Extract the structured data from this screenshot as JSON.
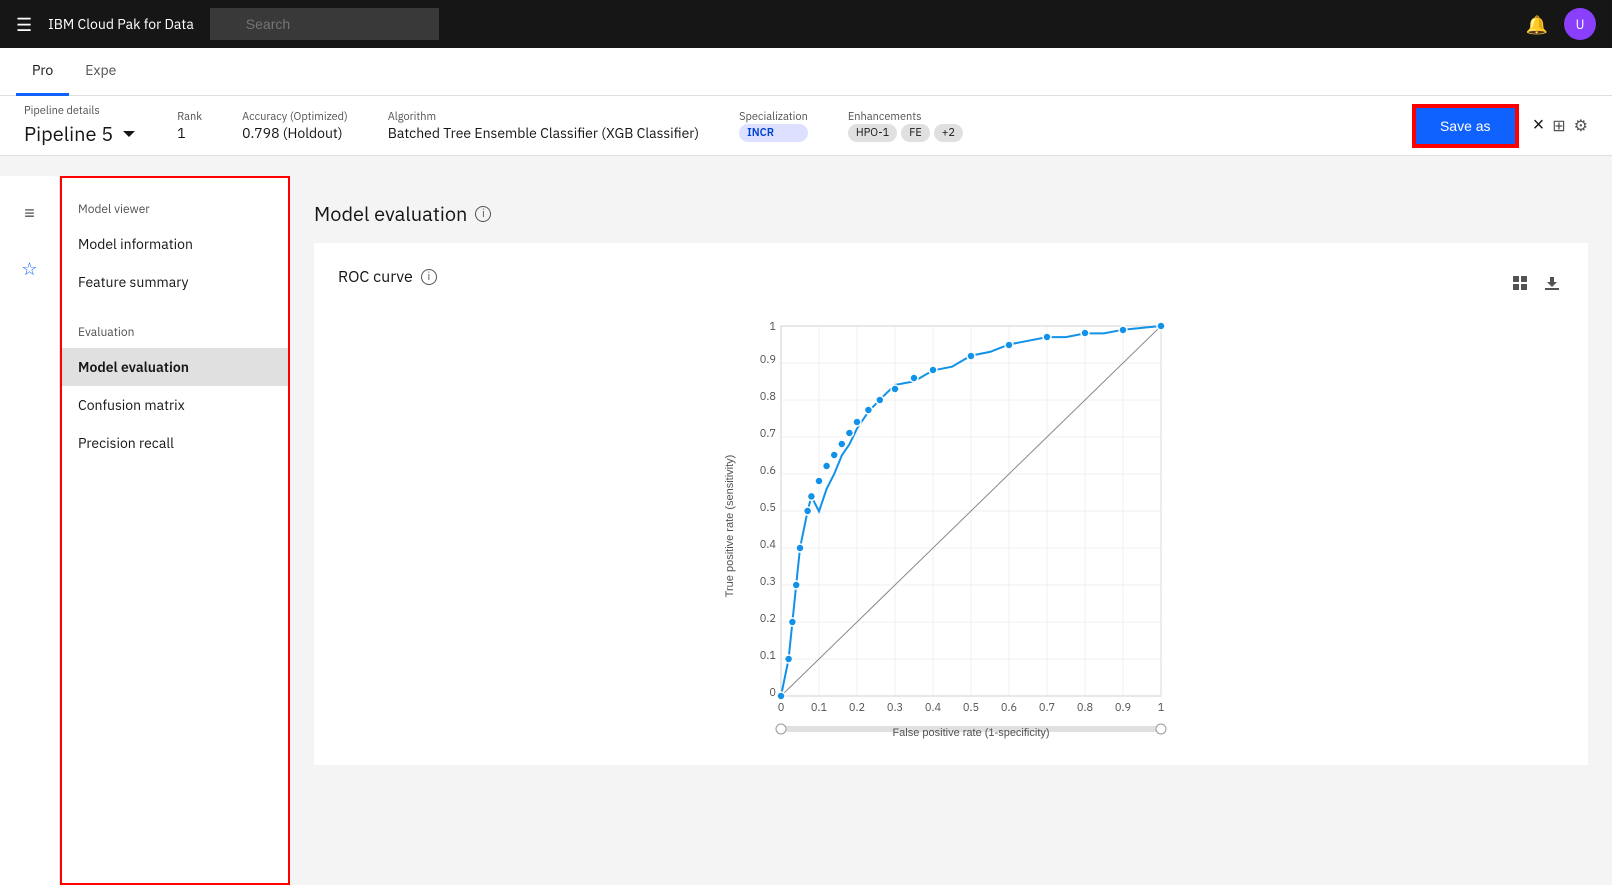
{
  "topnav": {
    "brand": "IBM Cloud Pak for Data",
    "search_placeholder": "Search",
    "menu_icon": "☰",
    "notification_icon": "🔔",
    "avatar_initials": "U"
  },
  "secondnav": {
    "tabs": [
      {
        "label": "Pro",
        "active": true
      },
      {
        "label": "Expe",
        "active": false
      }
    ]
  },
  "pipeline_header": {
    "details_label": "Pipeline details",
    "title": "Pipeline 5",
    "rank_label": "Rank",
    "rank_value": "1",
    "accuracy_label": "Accuracy (Optimized)",
    "accuracy_value": "0.798 (Holdout)",
    "algorithm_label": "Algorithm",
    "algorithm_value": "Batched Tree Ensemble Classifier (XGB Classifier)",
    "specialization_label": "Specialization",
    "specialization_badge": "INCR",
    "enhancements_label": "Enhancements",
    "enhancements": [
      "HPO-1",
      "FE",
      "+2"
    ],
    "save_as_label": "Save as",
    "close_label": "×"
  },
  "left_sidebar": {
    "icons": [
      "≡",
      "☆",
      "⊞"
    ]
  },
  "model_viewer": {
    "section_label": "Model viewer",
    "items": [
      {
        "label": "Model information",
        "active": false
      },
      {
        "label": "Feature summary",
        "active": false
      }
    ],
    "evaluation_label": "Evaluation",
    "eval_items": [
      {
        "label": "Model evaluation",
        "active": true
      },
      {
        "label": "Confusion matrix",
        "active": false
      },
      {
        "label": "Precision recall",
        "active": false
      }
    ]
  },
  "main": {
    "section_title": "Model evaluation",
    "chart_title": "ROC curve",
    "x_axis_label": "False positive rate (1-specificity)",
    "y_axis_label": "True positive rate (sensitivity)",
    "x_ticks": [
      "0",
      "0.1",
      "0.2",
      "0.3",
      "0.4",
      "0.5",
      "0.6",
      "0.7",
      "0.8",
      "0.9",
      "1"
    ],
    "y_ticks": [
      "0",
      "0.1",
      "0.2",
      "0.3",
      "0.4",
      "0.5",
      "0.6",
      "0.7",
      "0.8",
      "0.9",
      "1"
    ],
    "roc_points": [
      [
        0,
        0
      ],
      [
        0.02,
        0.1
      ],
      [
        0.03,
        0.2
      ],
      [
        0.04,
        0.3
      ],
      [
        0.05,
        0.4
      ],
      [
        0.07,
        0.48
      ],
      [
        0.08,
        0.52
      ],
      [
        0.1,
        0.58
      ],
      [
        0.12,
        0.63
      ],
      [
        0.14,
        0.67
      ],
      [
        0.16,
        0.7
      ],
      [
        0.18,
        0.73
      ],
      [
        0.2,
        0.76
      ],
      [
        0.23,
        0.79
      ],
      [
        0.26,
        0.81
      ],
      [
        0.3,
        0.83
      ],
      [
        0.35,
        0.86
      ],
      [
        0.4,
        0.88
      ],
      [
        0.45,
        0.89
      ],
      [
        0.5,
        0.92
      ],
      [
        0.55,
        0.93
      ],
      [
        0.6,
        0.95
      ],
      [
        0.65,
        0.96
      ],
      [
        0.7,
        0.97
      ],
      [
        0.75,
        0.97
      ],
      [
        0.8,
        0.98
      ],
      [
        0.85,
        0.98
      ],
      [
        0.9,
        0.99
      ],
      [
        0.95,
        0.995
      ],
      [
        1.0,
        1.0
      ]
    ],
    "diagonal_points": [
      [
        0,
        0
      ],
      [
        1,
        1
      ]
    ]
  }
}
